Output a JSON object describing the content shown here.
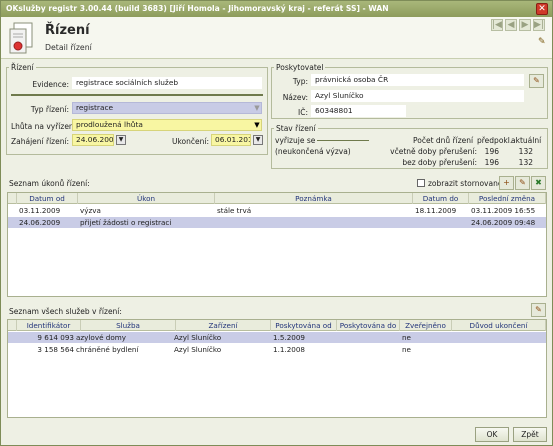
{
  "window": {
    "title": "OKslužby registr 3.00.44 (build 3683)  [Jiří Homola - Jihomoravský kraj - referát SS] - WAN"
  },
  "header": {
    "title": "Řízení",
    "subtitle": "Detail řízení"
  },
  "rizeni": {
    "legend": "Řízení",
    "evidence_label": "Evidence:",
    "evidence_value": "registrace sociálních služeb",
    "typ_label": "Typ řízení:",
    "typ_value": "registrace",
    "lhuta_label": "Lhůta na vyřízení:",
    "lhuta_value": "prodloužená lhůta",
    "zahajeni_label": "Zahájení řízení:",
    "zahajeni_value": "24.06.2009",
    "ukonceni_label": "Ukončení:",
    "ukonceni_value": "06.01.2010"
  },
  "poskytovatel": {
    "legend": "Poskytovatel",
    "typ_label": "Typ:",
    "typ_value": "právnická osoba ČR",
    "nazev_label": "Název:",
    "nazev_value": "Azyl Sluníčko",
    "ic_label": "IČ:",
    "ic_value": "60348801"
  },
  "stav": {
    "legend": "Stav řízení",
    "vyrizuje": "vyřizuje se",
    "neukoncena": "(neukončená výzva)",
    "pocet_label": "Počet dnů řízení",
    "predpokl_label": "předpokl.",
    "aktualni_label": "aktuální",
    "vcetne_label": "včetně doby přerušení:",
    "vcetne_predpokl": "196",
    "vcetne_aktualni": "132",
    "bez_label": "bez doby přerušení:",
    "bez_predpokl": "196",
    "bez_aktualni": "132"
  },
  "ukony": {
    "title": "Seznam úkonů řízení:",
    "stornovane_label": "zobrazit stornované",
    "columns": [
      "Datum od",
      "Úkon",
      "Poznámka",
      "Datum do",
      "Poslední změna"
    ],
    "rows": [
      [
        "03.11.2009",
        "výzva",
        "stále trvá",
        "18.11.2009",
        "03.11.2009 16:55"
      ],
      [
        "24.06.2009",
        "přijetí žádosti o registraci",
        "",
        "",
        "24.06.2009 09:48"
      ]
    ]
  },
  "sluzby": {
    "title": "Seznam všech služeb v řízení:",
    "columns": [
      "Identifikátor",
      "Služba",
      "Zařízení",
      "Poskytována od",
      "Poskytována do",
      "Zveřejněno",
      "Důvod ukončení"
    ],
    "rows": [
      [
        "9 614 093",
        "azylové domy",
        "Azyl Sluníčko",
        "1.5.2009",
        "",
        "ne",
        ""
      ],
      [
        "3 158 564",
        "chráněné bydlení",
        "Azyl Sluníčko",
        "1.1.2008",
        "",
        "ne",
        ""
      ]
    ]
  },
  "footer": {
    "ok": "OK",
    "back": "Zpět"
  },
  "icons": {
    "dropdown": "▼",
    "close": "✕",
    "prev": "◀",
    "next": "▶"
  }
}
